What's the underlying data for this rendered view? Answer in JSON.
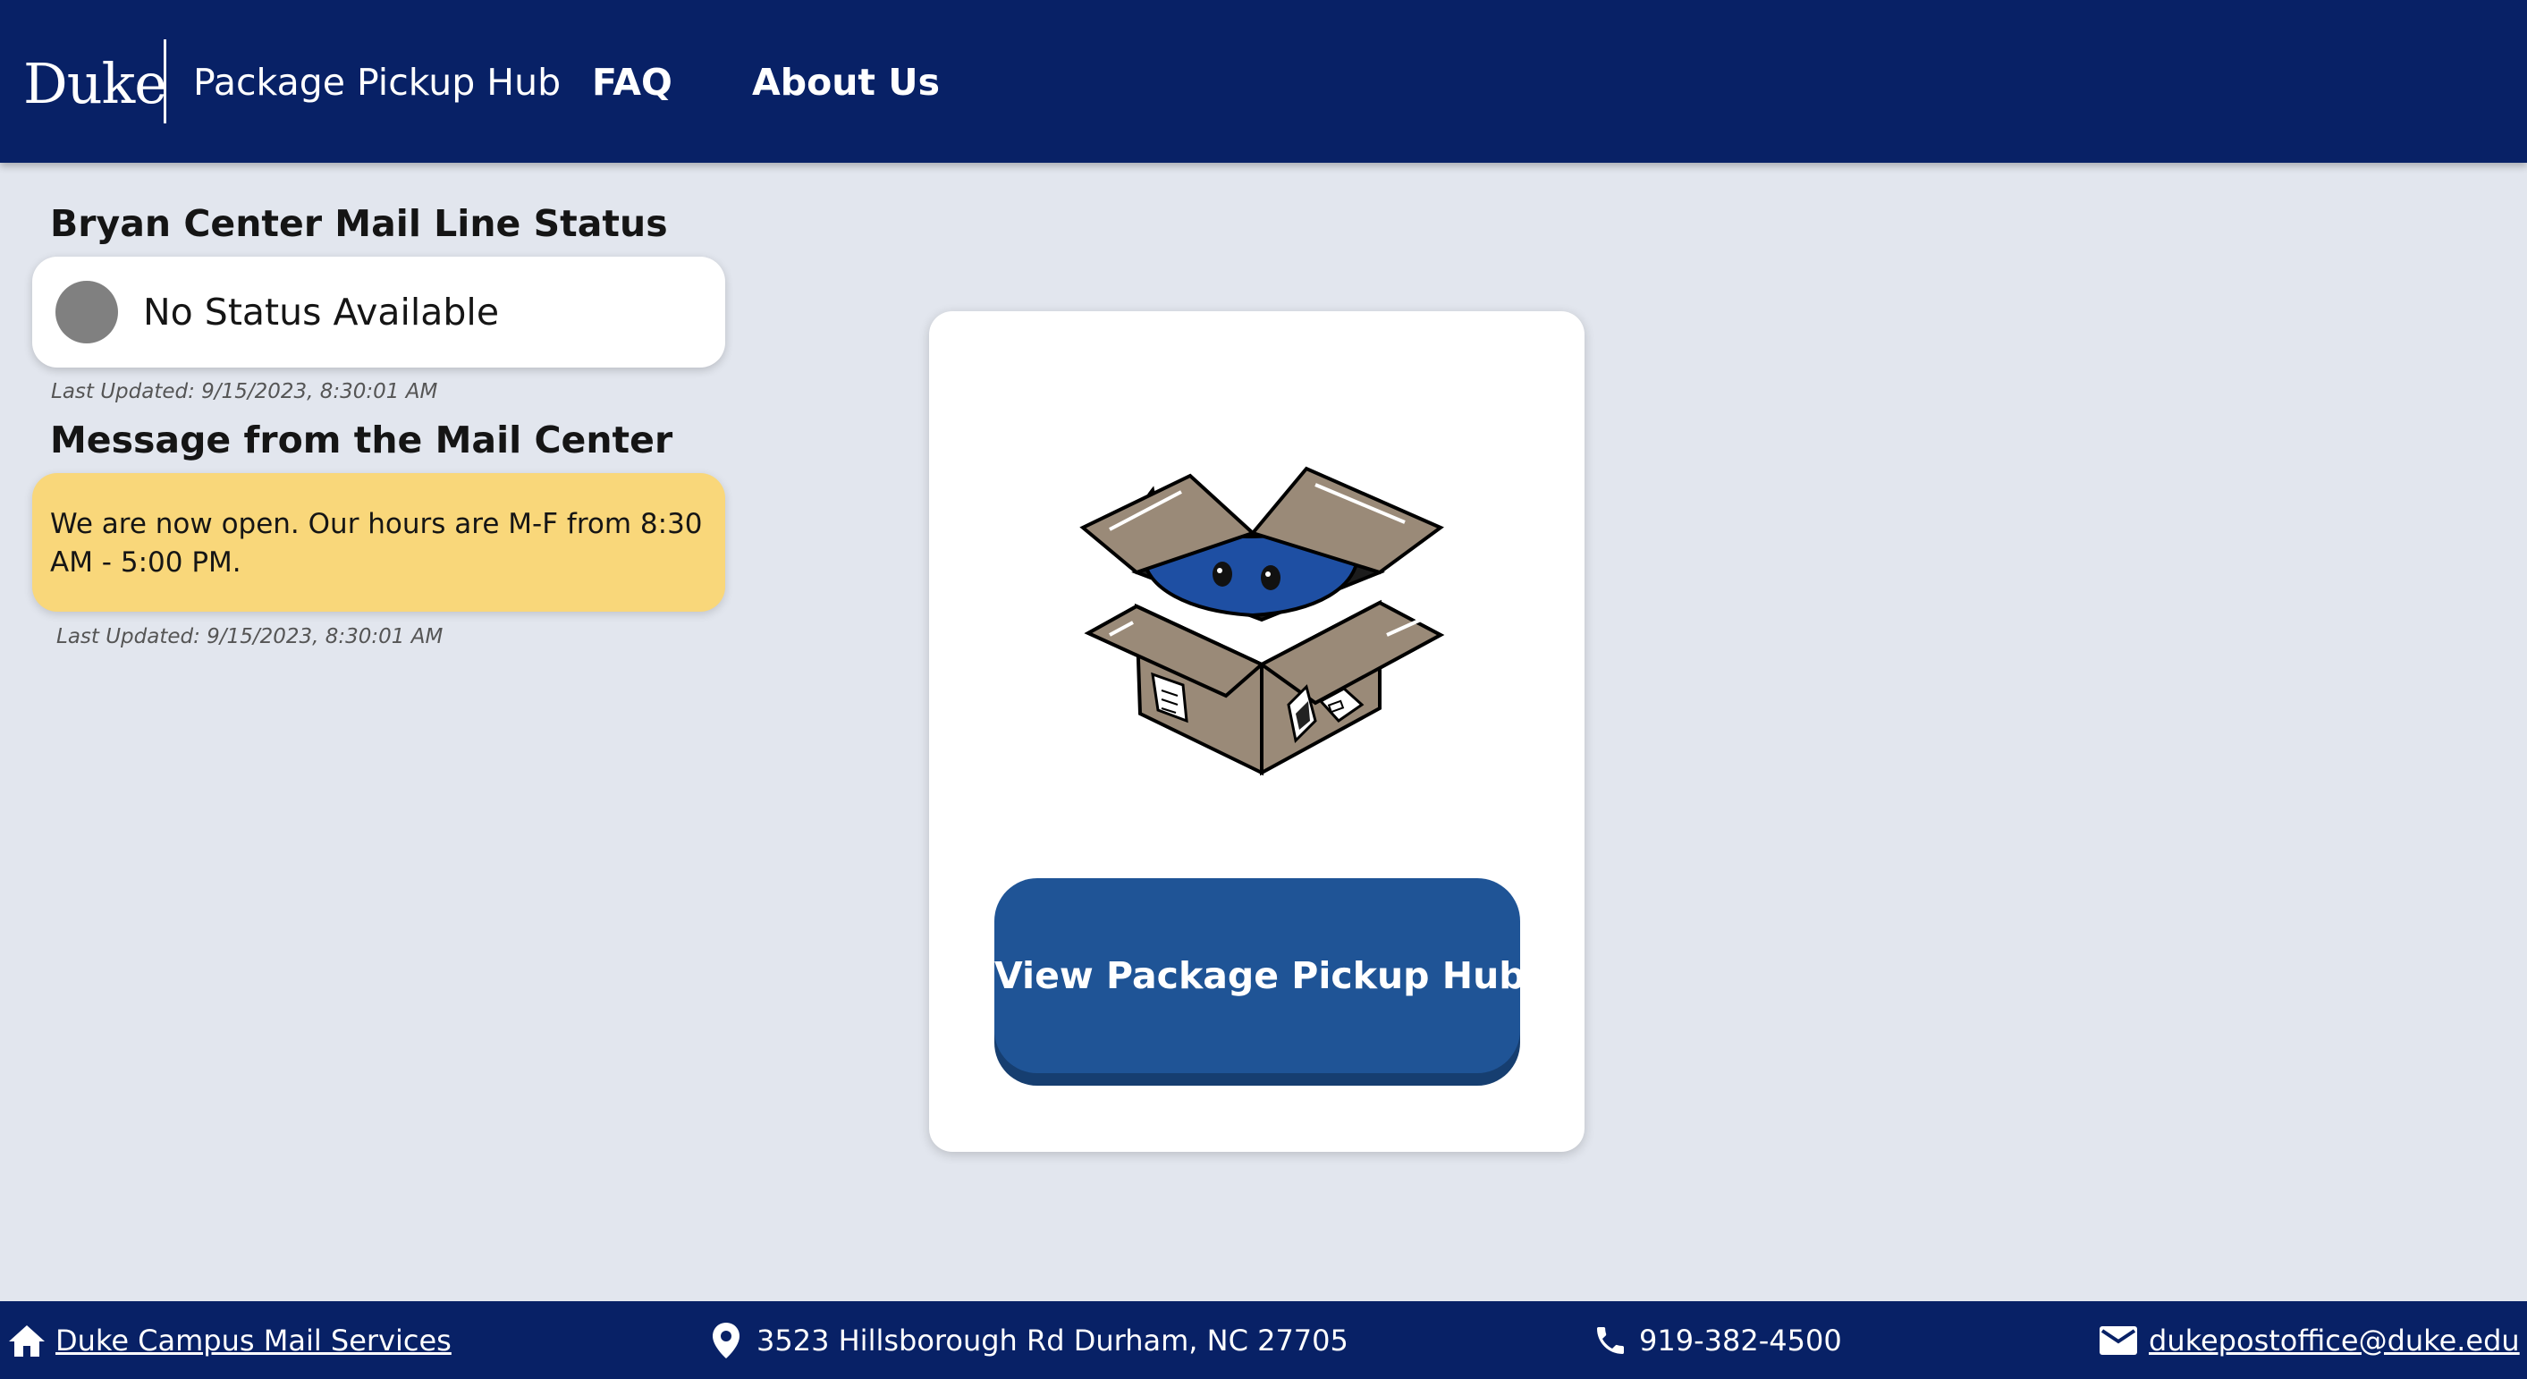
{
  "header": {
    "logo_text": "Duke",
    "site_name": "Package Pickup Hub",
    "nav": {
      "faq_label": "FAQ",
      "about_label": "About Us"
    }
  },
  "status": {
    "heading": "Bryan Center Mail Line Status",
    "status_text": "No Status Available",
    "status_color": "#808080",
    "last_updated": "Last Updated: 9/15/2023, 8:30:01 AM"
  },
  "message": {
    "heading": "Message from the Mail Center",
    "text": "We are now open. Our hours are M-F from 8:30 AM - 5:00 PM.",
    "last_updated": "Last Updated: 9/15/2023, 8:30:01 AM"
  },
  "hub_card": {
    "image_description_icon": "blue-devil-in-box-icon",
    "button_label": "View Package Pickup Hub"
  },
  "footer": {
    "home_link": "Duke Campus Mail Services",
    "address": "3523 Hillsborough Rd Durham, NC 27705",
    "phone": "919-382-4500",
    "email": "dukepostoffice@duke.edu"
  },
  "colors": {
    "navy": "#082166",
    "button_blue": "#1f5496",
    "message_yellow": "#f9d77a",
    "background": "#e2e6ee"
  }
}
